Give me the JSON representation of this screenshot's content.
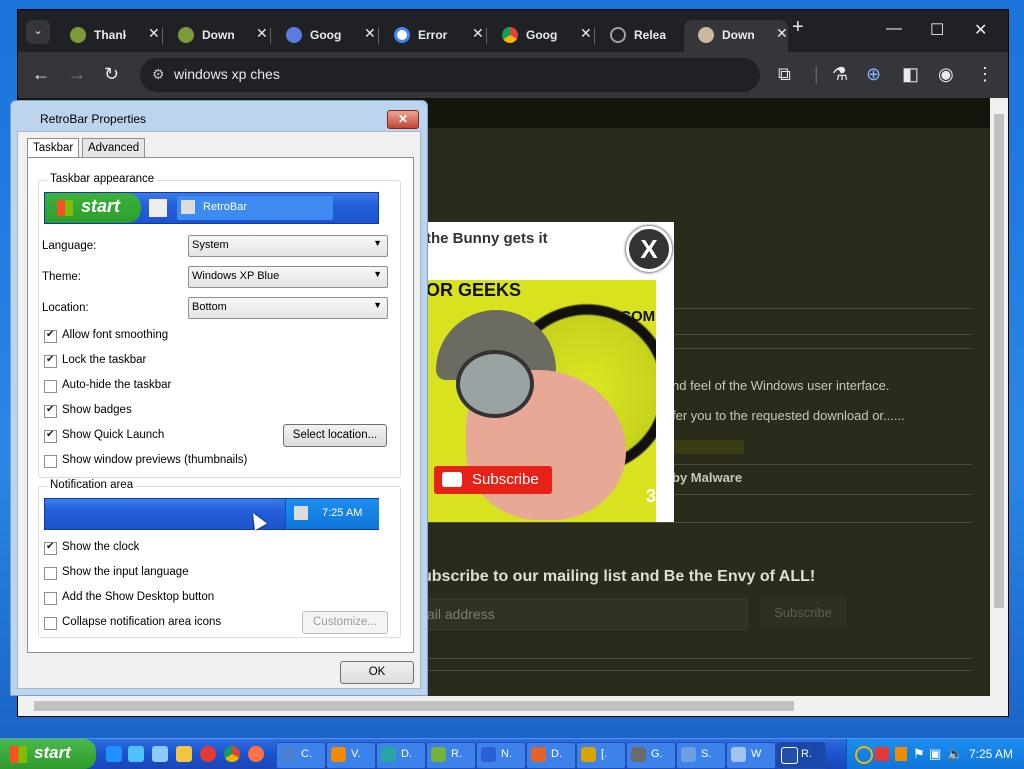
{
  "browser": {
    "tabs": [
      {
        "label": "Thank",
        "icon": "site-icon",
        "color": "#7c9a3a"
      },
      {
        "label": "Down",
        "icon": "site-icon",
        "color": "#7c9a3a"
      },
      {
        "label": "Googl",
        "icon": "site-icon",
        "color": "#5b7be0"
      },
      {
        "label": "Error",
        "icon": "google-icon",
        "color": "#ffffff"
      },
      {
        "label": "Googl",
        "icon": "chrome-icon",
        "color": "#e5b418"
      },
      {
        "label": "Relea",
        "icon": "github-icon",
        "color": "#9aa0a6"
      },
      {
        "label": "Down",
        "icon": "site-icon",
        "color": "#c9b9a0",
        "active": true
      }
    ],
    "new_tab": "+",
    "address": "windows xp ches",
    "minimize": "—",
    "maximize": "☐",
    "close": "✕"
  },
  "page": {
    "popup_title": "the Bunny gets it",
    "popup_dotcom": ".COM",
    "popup_top_text": "OR GEEKS",
    "subscribe_label": "Subscribe",
    "close_x": "X",
    "line1": "nd feel of the Windows user interface.",
    "line2": "fer you to the requested download or......",
    "line3": "by Malware",
    "line4": "3",
    "mailing_heading": "ubscribe to our mailing list and Be the Envy of ALL!",
    "email_placeholder": "ail address",
    "subscribe_button": "Subscribe"
  },
  "dialog": {
    "title": "RetroBar Properties",
    "close": "✕",
    "tabs": [
      "Taskbar",
      "Advanced"
    ],
    "appearance_group": "Taskbar appearance",
    "preview_start": "start",
    "preview_task": "RetroBar",
    "language_label": "Language:",
    "language_value": "System",
    "theme_label": "Theme:",
    "theme_value": "Windows XP Blue",
    "location_label": "Location:",
    "location_value": "Bottom",
    "checks": [
      {
        "label": "Allow font smoothing",
        "checked": true
      },
      {
        "label": "Lock the taskbar",
        "checked": true
      },
      {
        "label": "Auto-hide the taskbar",
        "checked": false
      },
      {
        "label": "Show badges",
        "checked": true
      },
      {
        "label": "Show Quick Launch",
        "checked": true
      },
      {
        "label": "Show window previews (thumbnails)",
        "checked": false
      }
    ],
    "select_location": "Select location...",
    "notification_group": "Notification area",
    "preview_clock": "7:25 AM",
    "notif_checks": [
      {
        "label": "Show the clock",
        "checked": true
      },
      {
        "label": "Show the input language",
        "checked": false
      },
      {
        "label": "Add the Show Desktop button",
        "checked": false
      },
      {
        "label": "Collapse notification area icons",
        "checked": false
      }
    ],
    "customize": "Customize...",
    "ok": "OK"
  },
  "taskbar": {
    "start": "start",
    "tasks": [
      {
        "label": "C.",
        "color": "#4a7fd4"
      },
      {
        "label": "V.",
        "color": "#f08a00"
      },
      {
        "label": "D.",
        "color": "#2aa3a3"
      },
      {
        "label": "R.",
        "color": "#74b43a"
      },
      {
        "label": "N.",
        "color": "#2a5fd8"
      },
      {
        "label": "D.",
        "color": "#e3642a"
      },
      {
        "label": "[.",
        "color": "#d9a400"
      },
      {
        "label": "G.",
        "color": "#6b6b6b"
      },
      {
        "label": "S.",
        "color": "#6aa0e0"
      },
      {
        "label": "W",
        "color": "#a0c4f0"
      },
      {
        "label": "R.",
        "color": "#244ea8"
      }
    ],
    "clock": "7:25 AM"
  }
}
